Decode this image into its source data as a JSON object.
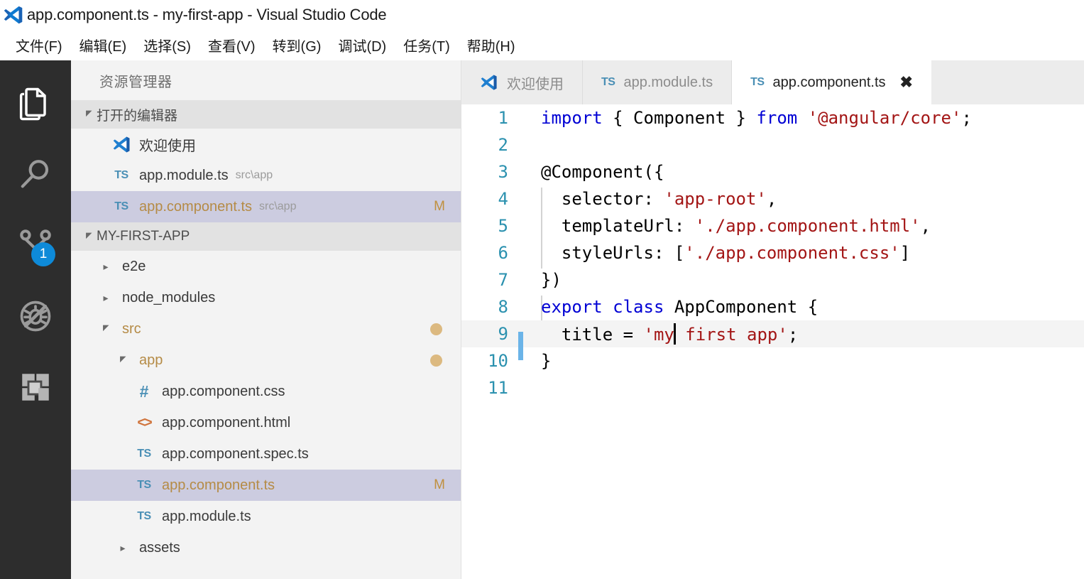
{
  "window": {
    "title": "app.component.ts - my-first-app - Visual Studio Code",
    "logo_icon": "vscode-logo-icon"
  },
  "menubar": {
    "items": [
      {
        "label": "文件(F)",
        "name": "menu-file"
      },
      {
        "label": "编辑(E)",
        "name": "menu-edit"
      },
      {
        "label": "选择(S)",
        "name": "menu-selection"
      },
      {
        "label": "查看(V)",
        "name": "menu-view"
      },
      {
        "label": "转到(G)",
        "name": "menu-go"
      },
      {
        "label": "调试(D)",
        "name": "menu-debug"
      },
      {
        "label": "任务(T)",
        "name": "menu-tasks"
      },
      {
        "label": "帮助(H)",
        "name": "menu-help"
      }
    ]
  },
  "activitybar": {
    "items": [
      {
        "icon": "files-explorer-icon",
        "active": true,
        "badge": null
      },
      {
        "icon": "search-magnifier-icon",
        "active": false,
        "badge": null
      },
      {
        "icon": "source-control-branch-icon",
        "active": false,
        "badge": "1"
      },
      {
        "icon": "debug-bug-icon",
        "active": false,
        "badge": null
      },
      {
        "icon": "extensions-squares-icon",
        "active": false,
        "badge": null
      }
    ],
    "badge_color": "#0e8ad8"
  },
  "sidebar": {
    "title": "资源管理器",
    "open_editors": {
      "header": "打开的编辑器",
      "expanded": true,
      "items": [
        {
          "icon": "vscode-logo-icon",
          "name": "欢迎使用",
          "path": "",
          "badge": "",
          "selected": false,
          "modified": false
        },
        {
          "icon": "ts-file-icon",
          "name": "app.module.ts",
          "path": "src\\app",
          "badge": "",
          "selected": false,
          "modified": false
        },
        {
          "icon": "ts-file-icon",
          "name": "app.component.ts",
          "path": "src\\app",
          "badge": "M",
          "selected": true,
          "modified": true
        }
      ]
    },
    "folder": {
      "header": "MY-FIRST-APP",
      "expanded": true,
      "items": [
        {
          "label": "e2e",
          "type": "folder",
          "expanded": false,
          "indent": 1,
          "icon": "",
          "selected": false,
          "modified": false,
          "badge": "",
          "dot": false
        },
        {
          "label": "node_modules",
          "type": "folder",
          "expanded": false,
          "indent": 1,
          "icon": "",
          "selected": false,
          "modified": false,
          "badge": "",
          "dot": false
        },
        {
          "label": "src",
          "type": "folder",
          "expanded": true,
          "indent": 1,
          "icon": "",
          "selected": false,
          "modified": true,
          "badge": "",
          "dot": true
        },
        {
          "label": "app",
          "type": "folder",
          "expanded": true,
          "indent": 2,
          "icon": "",
          "selected": false,
          "modified": true,
          "badge": "",
          "dot": true
        },
        {
          "label": "app.component.css",
          "type": "file",
          "expanded": false,
          "indent": 3,
          "icon": "css-file-icon",
          "selected": false,
          "modified": false,
          "badge": "",
          "dot": false
        },
        {
          "label": "app.component.html",
          "type": "file",
          "expanded": false,
          "indent": 3,
          "icon": "html-file-icon",
          "selected": false,
          "modified": false,
          "badge": "",
          "dot": false
        },
        {
          "label": "app.component.spec.ts",
          "type": "file",
          "expanded": false,
          "indent": 3,
          "icon": "ts-file-icon",
          "selected": false,
          "modified": false,
          "badge": "",
          "dot": false
        },
        {
          "label": "app.component.ts",
          "type": "file",
          "expanded": false,
          "indent": 3,
          "icon": "ts-file-icon",
          "selected": true,
          "modified": true,
          "badge": "M",
          "dot": false
        },
        {
          "label": "app.module.ts",
          "type": "file",
          "expanded": false,
          "indent": 3,
          "icon": "ts-file-icon",
          "selected": false,
          "modified": false,
          "badge": "",
          "dot": false
        },
        {
          "label": "assets",
          "type": "folder",
          "expanded": false,
          "indent": 2,
          "icon": "",
          "selected": false,
          "modified": false,
          "badge": "",
          "dot": false
        }
      ]
    }
  },
  "editor": {
    "tabs": [
      {
        "label": "欢迎使用",
        "icon": "vscode-logo-icon",
        "active": false,
        "closable": false
      },
      {
        "label": "app.module.ts",
        "icon": "ts-file-icon",
        "active": false,
        "closable": false
      },
      {
        "label": "app.component.ts",
        "icon": "ts-file-icon",
        "active": true,
        "closable": true,
        "close_label": "✖"
      }
    ],
    "line_numbers": [
      "1",
      "2",
      "3",
      "4",
      "5",
      "6",
      "7",
      "8",
      "9",
      "10",
      "11"
    ],
    "current_line": 9,
    "cursor_column_text": "my",
    "code": {
      "l1": {
        "kw1": "import",
        "p1": " { Component } ",
        "kw2": "from",
        "p2": " ",
        "s1": "'@angular/core'",
        "p3": ";"
      },
      "l2": "",
      "l3": "@Component({",
      "l4_plain": "  selector: ",
      "l4_str": "'app-root'",
      "l4_end": ",",
      "l5_plain": "  templateUrl: ",
      "l5_str": "'./app.component.html'",
      "l5_end": ",",
      "l6_plain": "  styleUrls: [",
      "l6_str": "'./app.component.css'",
      "l6_end": "]",
      "l7": "})",
      "l8_kw1": "export",
      "l8_sp1": " ",
      "l8_kw2": "class",
      "l8_plain": " AppComponent {",
      "l9_plain": "  title = ",
      "l9_str_a": "'my",
      "l9_str_b": " first app'",
      "l9_end": ";",
      "l10": "}",
      "l11": ""
    }
  },
  "colors": {
    "accent": "#007acc",
    "keyword": "#0000d4",
    "string": "#a31515",
    "linenumber": "#2b91af",
    "selection": "#cccce0",
    "modified_badge": "#c0903f",
    "modified_dot": "#dcb980"
  }
}
